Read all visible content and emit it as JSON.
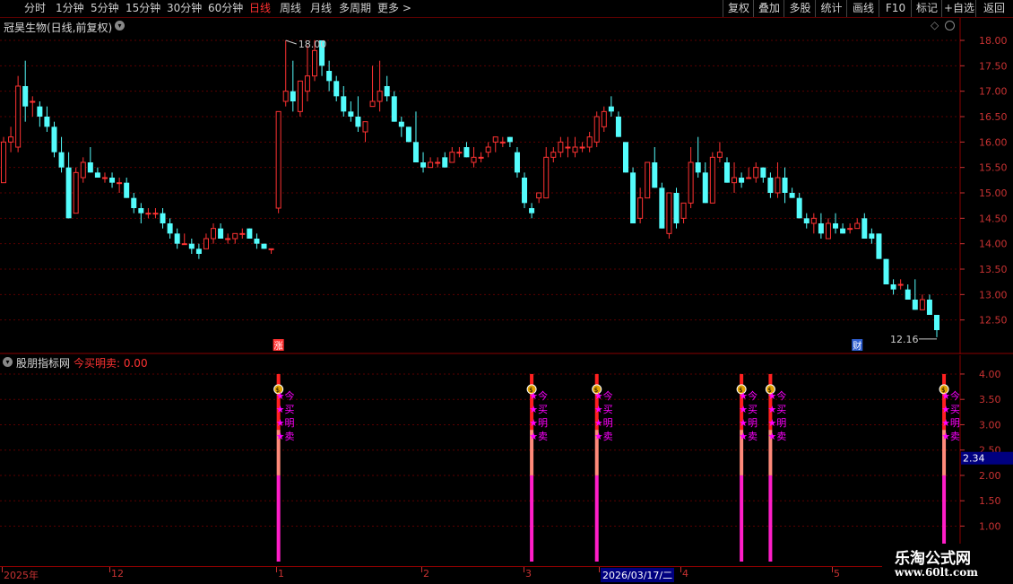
{
  "toolbar": {
    "periods": [
      {
        "label": "分时",
        "active": false
      },
      {
        "label": "1分钟",
        "active": false
      },
      {
        "label": "5分钟",
        "active": false
      },
      {
        "label": "15分钟",
        "active": false
      },
      {
        "label": "30分钟",
        "active": false
      },
      {
        "label": "60分钟",
        "active": false
      },
      {
        "label": "日线",
        "active": true
      },
      {
        "label": "周线",
        "active": false
      },
      {
        "label": "月线",
        "active": false
      },
      {
        "label": "多周期",
        "active": false
      },
      {
        "label": "更多 >",
        "active": false
      }
    ],
    "right_buttons": [
      "复权",
      "叠加",
      "多股",
      "统计",
      "画线",
      "F10",
      "标记",
      "+自选",
      "返回"
    ]
  },
  "main_chart": {
    "title": "冠昊生物(日线,前复权)",
    "high_label": "18.00",
    "low_label": "12.16",
    "marker_zhang": "涨",
    "marker_cai": "财",
    "y_ticks": [
      "18.00",
      "17.50",
      "17.00",
      "16.50",
      "16.00",
      "15.50",
      "15.00",
      "14.50",
      "14.00",
      "13.50",
      "13.00",
      "12.50"
    ]
  },
  "indicator": {
    "title": "股朋指标网",
    "value_label": "今买明卖: 0.00",
    "signal_text": [
      "★今",
      "★买",
      "★明",
      "★卖"
    ],
    "y_ticks": [
      "4.00",
      "3.50",
      "3.00",
      "2.50",
      "2.00",
      "1.50",
      "1.00"
    ],
    "current_value": "2.34"
  },
  "date_axis": {
    "labels": [
      "2025年",
      "12",
      "1",
      "2",
      "3",
      "2026/03/17/二",
      "4",
      "5"
    ]
  },
  "watermark": {
    "line1": "乐淘公式网",
    "line2": "www.60lt.com"
  },
  "colors": {
    "up": "#ff3232",
    "down": "#54fcfc",
    "grid": "#5a0000",
    "axis_text": "#c83232",
    "magenta": "#ff00ff",
    "bg": "#000000"
  },
  "chart_data": {
    "type": "candlestick",
    "ylim": [
      12.0,
      18.3
    ],
    "candles": [
      {
        "o": 15.2,
        "h": 16.1,
        "l": 15.2,
        "c": 16.0
      },
      {
        "o": 16.0,
        "h": 16.3,
        "l": 15.8,
        "c": 16.1
      },
      {
        "o": 15.9,
        "h": 17.3,
        "l": 15.8,
        "c": 17.1
      },
      {
        "o": 17.1,
        "h": 17.6,
        "l": 16.4,
        "c": 16.7
      },
      {
        "o": 16.8,
        "h": 16.9,
        "l": 16.5,
        "c": 16.8
      },
      {
        "o": 16.7,
        "h": 16.8,
        "l": 16.3,
        "c": 16.5
      },
      {
        "o": 16.5,
        "h": 16.7,
        "l": 16.2,
        "c": 16.3
      },
      {
        "o": 16.3,
        "h": 16.4,
        "l": 15.7,
        "c": 15.8
      },
      {
        "o": 15.8,
        "h": 16.1,
        "l": 15.4,
        "c": 15.5
      },
      {
        "o": 15.5,
        "h": 15.8,
        "l": 14.5,
        "c": 14.5
      },
      {
        "o": 14.6,
        "h": 15.5,
        "l": 14.6,
        "c": 15.4
      },
      {
        "o": 15.3,
        "h": 15.7,
        "l": 15.2,
        "c": 15.6
      },
      {
        "o": 15.6,
        "h": 15.9,
        "l": 15.4,
        "c": 15.4
      },
      {
        "o": 15.4,
        "h": 15.5,
        "l": 15.3,
        "c": 15.3
      },
      {
        "o": 15.3,
        "h": 15.4,
        "l": 15.2,
        "c": 15.3
      },
      {
        "o": 15.3,
        "h": 15.4,
        "l": 15.1,
        "c": 15.2
      },
      {
        "o": 15.2,
        "h": 15.3,
        "l": 15.0,
        "c": 15.2
      },
      {
        "o": 15.2,
        "h": 15.3,
        "l": 14.9,
        "c": 14.9
      },
      {
        "o": 14.9,
        "h": 15.0,
        "l": 14.6,
        "c": 14.7
      },
      {
        "o": 14.7,
        "h": 14.8,
        "l": 14.4,
        "c": 14.6
      },
      {
        "o": 14.6,
        "h": 14.7,
        "l": 14.5,
        "c": 14.6
      },
      {
        "o": 14.6,
        "h": 14.7,
        "l": 14.5,
        "c": 14.6
      },
      {
        "o": 14.6,
        "h": 14.7,
        "l": 14.3,
        "c": 14.4
      },
      {
        "o": 14.4,
        "h": 14.5,
        "l": 14.1,
        "c": 14.2
      },
      {
        "o": 14.2,
        "h": 14.3,
        "l": 13.9,
        "c": 14.0
      },
      {
        "o": 14.0,
        "h": 14.2,
        "l": 14.0,
        "c": 14.0
      },
      {
        "o": 14.0,
        "h": 14.1,
        "l": 13.8,
        "c": 13.9
      },
      {
        "o": 13.9,
        "h": 14.0,
        "l": 13.7,
        "c": 13.8
      },
      {
        "o": 13.9,
        "h": 14.2,
        "l": 13.9,
        "c": 14.1
      },
      {
        "o": 14.1,
        "h": 14.4,
        "l": 14.0,
        "c": 14.3
      },
      {
        "o": 14.3,
        "h": 14.4,
        "l": 14.1,
        "c": 14.1
      },
      {
        "o": 14.1,
        "h": 14.2,
        "l": 14.0,
        "c": 14.1
      },
      {
        "o": 14.1,
        "h": 14.2,
        "l": 14.0,
        "c": 14.2
      },
      {
        "o": 14.2,
        "h": 14.3,
        "l": 14.1,
        "c": 14.2
      },
      {
        "o": 14.3,
        "h": 14.3,
        "l": 14.1,
        "c": 14.1
      },
      {
        "o": 14.1,
        "h": 14.2,
        "l": 13.9,
        "c": 14.0
      },
      {
        "o": 14.0,
        "h": 14.0,
        "l": 13.9,
        "c": 13.9
      },
      {
        "o": 13.9,
        "h": 13.9,
        "l": 13.8,
        "c": 13.9
      },
      {
        "o": 14.7,
        "h": 16.6,
        "l": 14.6,
        "c": 16.6
      },
      {
        "o": 16.8,
        "h": 18.0,
        "l": 16.7,
        "c": 17.0
      },
      {
        "o": 17.0,
        "h": 17.6,
        "l": 16.6,
        "c": 16.8
      },
      {
        "o": 16.6,
        "h": 17.2,
        "l": 16.5,
        "c": 17.2
      },
      {
        "o": 17.0,
        "h": 17.9,
        "l": 16.8,
        "c": 17.3
      },
      {
        "o": 17.3,
        "h": 18.0,
        "l": 17.2,
        "c": 17.8
      },
      {
        "o": 18.0,
        "h": 18.0,
        "l": 17.3,
        "c": 17.5
      },
      {
        "o": 17.4,
        "h": 17.6,
        "l": 17.0,
        "c": 17.2
      },
      {
        "o": 17.2,
        "h": 17.3,
        "l": 16.8,
        "c": 16.9
      },
      {
        "o": 16.9,
        "h": 17.1,
        "l": 16.5,
        "c": 16.6
      },
      {
        "o": 16.6,
        "h": 16.8,
        "l": 16.4,
        "c": 16.5
      },
      {
        "o": 16.5,
        "h": 16.9,
        "l": 16.2,
        "c": 16.3
      },
      {
        "o": 16.2,
        "h": 16.4,
        "l": 16.0,
        "c": 16.4
      },
      {
        "o": 16.7,
        "h": 17.5,
        "l": 16.7,
        "c": 16.8
      },
      {
        "o": 16.8,
        "h": 17.6,
        "l": 16.6,
        "c": 17.0
      },
      {
        "o": 17.1,
        "h": 17.3,
        "l": 16.8,
        "c": 16.9
      },
      {
        "o": 16.9,
        "h": 17.0,
        "l": 16.4,
        "c": 16.4
      },
      {
        "o": 16.4,
        "h": 16.5,
        "l": 16.1,
        "c": 16.3
      },
      {
        "o": 16.3,
        "h": 16.3,
        "l": 16.0,
        "c": 16.0
      },
      {
        "o": 16.0,
        "h": 16.6,
        "l": 15.6,
        "c": 15.6
      },
      {
        "o": 15.6,
        "h": 15.8,
        "l": 15.4,
        "c": 15.5
      },
      {
        "o": 15.5,
        "h": 15.7,
        "l": 15.5,
        "c": 15.6
      },
      {
        "o": 15.6,
        "h": 15.7,
        "l": 15.5,
        "c": 15.6
      },
      {
        "o": 15.7,
        "h": 15.8,
        "l": 15.5,
        "c": 15.5
      },
      {
        "o": 15.6,
        "h": 15.9,
        "l": 15.6,
        "c": 15.8
      },
      {
        "o": 15.8,
        "h": 15.9,
        "l": 15.7,
        "c": 15.8
      },
      {
        "o": 15.9,
        "h": 16.0,
        "l": 15.7,
        "c": 15.7
      },
      {
        "o": 15.6,
        "h": 15.9,
        "l": 15.5,
        "c": 15.7
      },
      {
        "o": 15.7,
        "h": 15.8,
        "l": 15.6,
        "c": 15.7
      },
      {
        "o": 15.8,
        "h": 16.0,
        "l": 15.7,
        "c": 15.9
      },
      {
        "o": 16.0,
        "h": 16.1,
        "l": 15.8,
        "c": 16.1
      },
      {
        "o": 16.0,
        "h": 16.1,
        "l": 15.9,
        "c": 16.0
      },
      {
        "o": 16.1,
        "h": 16.1,
        "l": 15.9,
        "c": 16.0
      },
      {
        "o": 15.8,
        "h": 15.9,
        "l": 15.3,
        "c": 15.4
      },
      {
        "o": 15.3,
        "h": 15.4,
        "l": 14.7,
        "c": 14.8
      },
      {
        "o": 14.7,
        "h": 14.8,
        "l": 14.5,
        "c": 14.6
      },
      {
        "o": 14.9,
        "h": 15.0,
        "l": 14.8,
        "c": 15.0
      },
      {
        "o": 14.9,
        "h": 15.9,
        "l": 14.9,
        "c": 15.7
      },
      {
        "o": 15.7,
        "h": 15.9,
        "l": 15.6,
        "c": 15.8
      },
      {
        "o": 15.8,
        "h": 16.1,
        "l": 15.7,
        "c": 16.0
      },
      {
        "o": 15.9,
        "h": 16.1,
        "l": 15.7,
        "c": 15.9
      },
      {
        "o": 15.8,
        "h": 16.1,
        "l": 15.7,
        "c": 15.9
      },
      {
        "o": 15.9,
        "h": 16.0,
        "l": 15.8,
        "c": 15.9
      },
      {
        "o": 15.9,
        "h": 16.2,
        "l": 15.8,
        "c": 16.1
      },
      {
        "o": 16.0,
        "h": 16.6,
        "l": 15.9,
        "c": 16.5
      },
      {
        "o": 16.3,
        "h": 16.7,
        "l": 16.2,
        "c": 16.6
      },
      {
        "o": 16.7,
        "h": 16.9,
        "l": 16.5,
        "c": 16.6
      },
      {
        "o": 16.5,
        "h": 16.6,
        "l": 16.1,
        "c": 16.1
      },
      {
        "o": 16.0,
        "h": 16.0,
        "l": 15.4,
        "c": 15.4
      },
      {
        "o": 15.4,
        "h": 15.5,
        "l": 14.4,
        "c": 14.4
      },
      {
        "o": 14.5,
        "h": 15.1,
        "l": 14.4,
        "c": 14.9
      },
      {
        "o": 14.9,
        "h": 15.6,
        "l": 14.9,
        "c": 15.6
      },
      {
        "o": 15.6,
        "h": 15.9,
        "l": 15.1,
        "c": 15.1
      },
      {
        "o": 15.1,
        "h": 15.2,
        "l": 14.3,
        "c": 14.3
      },
      {
        "o": 14.2,
        "h": 15.0,
        "l": 14.1,
        "c": 15.0
      },
      {
        "o": 15.0,
        "h": 15.1,
        "l": 14.3,
        "c": 14.4
      },
      {
        "o": 14.5,
        "h": 14.8,
        "l": 14.4,
        "c": 14.8
      },
      {
        "o": 14.8,
        "h": 15.9,
        "l": 14.7,
        "c": 15.6
      },
      {
        "o": 15.6,
        "h": 16.1,
        "l": 15.3,
        "c": 15.4
      },
      {
        "o": 15.4,
        "h": 15.6,
        "l": 14.8,
        "c": 14.8
      },
      {
        "o": 14.8,
        "h": 15.8,
        "l": 14.8,
        "c": 15.7
      },
      {
        "o": 15.7,
        "h": 16.0,
        "l": 15.6,
        "c": 15.8
      },
      {
        "o": 15.6,
        "h": 15.7,
        "l": 15.2,
        "c": 15.2
      },
      {
        "o": 15.2,
        "h": 15.6,
        "l": 15.0,
        "c": 15.3
      },
      {
        "o": 15.3,
        "h": 15.4,
        "l": 15.1,
        "c": 15.2
      },
      {
        "o": 15.3,
        "h": 15.5,
        "l": 15.3,
        "c": 15.3
      },
      {
        "o": 15.3,
        "h": 15.6,
        "l": 15.2,
        "c": 15.5
      },
      {
        "o": 15.5,
        "h": 15.5,
        "l": 15.2,
        "c": 15.3
      },
      {
        "o": 15.3,
        "h": 15.4,
        "l": 14.9,
        "c": 15.0
      },
      {
        "o": 15.0,
        "h": 15.6,
        "l": 14.9,
        "c": 15.3
      },
      {
        "o": 15.3,
        "h": 15.5,
        "l": 14.8,
        "c": 15.0
      },
      {
        "o": 15.0,
        "h": 15.1,
        "l": 14.9,
        "c": 14.9
      },
      {
        "o": 14.9,
        "h": 15.0,
        "l": 14.5,
        "c": 14.5
      },
      {
        "o": 14.5,
        "h": 14.6,
        "l": 14.3,
        "c": 14.4
      },
      {
        "o": 14.4,
        "h": 14.6,
        "l": 14.2,
        "c": 14.5
      },
      {
        "o": 14.4,
        "h": 14.6,
        "l": 14.1,
        "c": 14.2
      },
      {
        "o": 14.1,
        "h": 14.5,
        "l": 14.1,
        "c": 14.4
      },
      {
        "o": 14.4,
        "h": 14.6,
        "l": 14.2,
        "c": 14.3
      },
      {
        "o": 14.3,
        "h": 14.4,
        "l": 14.2,
        "c": 14.2
      },
      {
        "o": 14.3,
        "h": 14.4,
        "l": 14.2,
        "c": 14.3
      },
      {
        "o": 14.3,
        "h": 14.5,
        "l": 14.3,
        "c": 14.4
      },
      {
        "o": 14.5,
        "h": 14.6,
        "l": 14.1,
        "c": 14.1
      },
      {
        "o": 14.2,
        "h": 14.3,
        "l": 14.0,
        "c": 14.1
      },
      {
        "o": 14.2,
        "h": 14.2,
        "l": 13.7,
        "c": 13.7
      },
      {
        "o": 13.7,
        "h": 13.7,
        "l": 13.2,
        "c": 13.2
      },
      {
        "o": 13.2,
        "h": 13.3,
        "l": 13.0,
        "c": 13.1
      },
      {
        "o": 13.2,
        "h": 13.3,
        "l": 13.1,
        "c": 13.2
      },
      {
        "o": 13.1,
        "h": 13.2,
        "l": 12.9,
        "c": 12.9
      },
      {
        "o": 12.9,
        "h": 13.3,
        "l": 12.7,
        "c": 12.7
      },
      {
        "o": 12.7,
        "h": 13.0,
        "l": 12.7,
        "c": 12.9
      },
      {
        "o": 12.9,
        "h": 13.0,
        "l": 12.6,
        "c": 12.6
      },
      {
        "o": 12.6,
        "h": 12.6,
        "l": 12.16,
        "c": 12.3
      }
    ],
    "signals": [
      {
        "index": 38,
        "bar_value": 4.0
      },
      {
        "index": 73,
        "bar_value": 4.0
      },
      {
        "index": 82,
        "bar_value": 4.0
      },
      {
        "index": 102,
        "bar_value": 4.0
      },
      {
        "index": 106,
        "bar_value": 4.0
      },
      {
        "index": 130,
        "bar_value": 4.0
      }
    ],
    "indicator_ylim": [
      0.3,
      4.3
    ]
  }
}
